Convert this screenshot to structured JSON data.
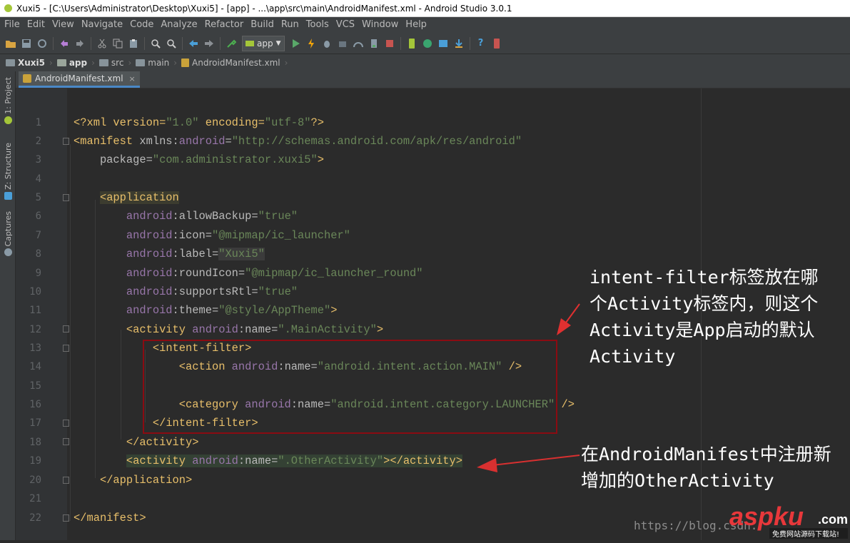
{
  "window": {
    "title": "Xuxi5 - [C:\\Users\\Administrator\\Desktop\\Xuxi5] - [app] - ...\\app\\src\\main\\AndroidManifest.xml - Android Studio 3.0.1"
  },
  "menu": [
    "File",
    "Edit",
    "View",
    "Navigate",
    "Code",
    "Analyze",
    "Refactor",
    "Build",
    "Run",
    "Tools",
    "VCS",
    "Window",
    "Help"
  ],
  "toolbar": {
    "run_config": "app"
  },
  "breadcrumb": [
    "Xuxi5",
    "app",
    "src",
    "main",
    "AndroidManifest.xml"
  ],
  "editor_tab": {
    "label": "AndroidManifest.xml",
    "close": "×"
  },
  "side_tabs": [
    "1: Project",
    "Z: Structure",
    "Captures"
  ],
  "line_numbers": [
    "1",
    "2",
    "3",
    "4",
    "5",
    "6",
    "7",
    "8",
    "9",
    "10",
    "11",
    "12",
    "13",
    "14",
    "15",
    "16",
    "17",
    "18",
    "19",
    "20",
    "21",
    "22"
  ],
  "code": {
    "l1": [
      "<?xml version=",
      "\"1.0\"",
      " encoding=",
      "\"utf-8\"",
      "?>"
    ],
    "l2": [
      "<manifest ",
      "xmlns:",
      "android",
      "=",
      "\"http://schemas.android.com/apk/res/android\""
    ],
    "l3": [
      "    package=",
      "\"com.administrator.xuxi5\"",
      ">"
    ],
    "l5": [
      "    ",
      "<application"
    ],
    "l6": [
      "        ",
      "android",
      ":allowBackup=",
      "\"true\""
    ],
    "l7": [
      "        ",
      "android",
      ":icon=",
      "\"@mipmap/ic_launcher\""
    ],
    "l8": [
      "        ",
      "android",
      ":label=",
      "\"Xuxi5\""
    ],
    "l9": [
      "        ",
      "android",
      ":roundIcon=",
      "\"@mipmap/ic_launcher_round\""
    ],
    "l10": [
      "        ",
      "android",
      ":supportsRtl=",
      "\"true\""
    ],
    "l11": [
      "        ",
      "android",
      ":theme=",
      "\"@style/AppTheme\"",
      ">"
    ],
    "l12": [
      "        ",
      "<activity ",
      "android",
      ":name=",
      "\".MainActivity\"",
      ">"
    ],
    "l13": [
      "            ",
      "<intent-filter>"
    ],
    "l14": [
      "                ",
      "<action ",
      "android",
      ":name=",
      "\"android.intent.action.MAIN\"",
      " />"
    ],
    "l16": [
      "                ",
      "<category ",
      "android",
      ":name=",
      "\"android.intent.category.LAUNCHER\"",
      " />"
    ],
    "l17": [
      "            ",
      "</intent-filter>"
    ],
    "l18": [
      "        ",
      "</activity>"
    ],
    "l19": [
      "        ",
      "<activity ",
      "android",
      ":name=",
      "\".OtherActivity\"",
      "></activity>"
    ],
    "l20": [
      "    ",
      "</application>"
    ],
    "l22": [
      "</manifest>"
    ]
  },
  "annotations": {
    "intent_filter_note": [
      "intent-filter标签放在哪",
      "个Activity标签内，则这个",
      "Activity是App启动的默认",
      "Activity"
    ],
    "register_note": [
      "在AndroidManifest中注册新",
      "增加的OtherActivity"
    ]
  },
  "watermark": {
    "url": "https://blog.csdn.",
    "logo_text": "aspku",
    "logo_suffix": ".com",
    "logo_tagline": "免费网站源码下载站!"
  },
  "colors": {
    "tag": "#e8bf6a",
    "string": "#6a8759",
    "namespace": "#9876aa",
    "attribute": "#bababa",
    "annotation_box": "#8b0b12",
    "arrow": "#e03030"
  }
}
